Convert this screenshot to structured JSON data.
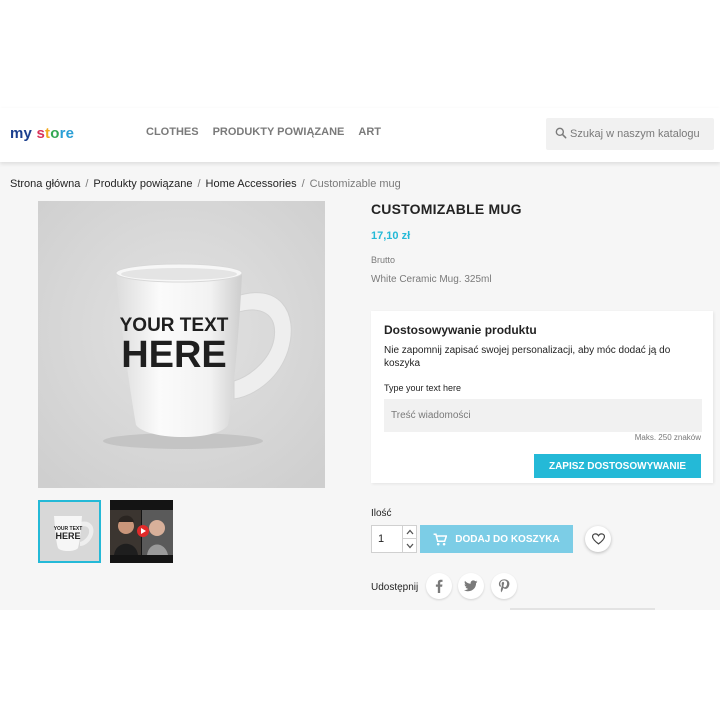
{
  "header": {
    "logo": {
      "part1": "my ",
      "part2": "s",
      "part3": "t",
      "part4": "o",
      "part5": "re"
    },
    "nav": [
      "CLOTHES",
      "PRODUKTY POWIĄZANE",
      "ART"
    ],
    "search_placeholder": "Szukaj w naszym katalogu"
  },
  "breadcrumb": [
    "Strona główna",
    "Produkty powiązane",
    "Home Accessories",
    "Customizable mug"
  ],
  "product": {
    "image_text_line1": "YOUR TEXT",
    "image_text_line2": "HERE",
    "title": "CUSTOMIZABLE MUG",
    "price": "17,10 zł",
    "tax_label": "Brutto",
    "description": "White Ceramic Mug. 325ml"
  },
  "customization": {
    "title": "Dostosowywanie produktu",
    "note": "Nie zapomnij zapisać swojej personalizacji, aby móc dodać ją do koszyka",
    "field_label": "Type your text here",
    "placeholder": "Treść wiadomości",
    "limit": "Maks. 250 znaków",
    "save_label": "ZAPISZ DOSTOSOWYWANIE"
  },
  "purchase": {
    "qty_label": "Ilość",
    "qty_value": "1",
    "add_label": "DODAJ DO KOSZYKA"
  },
  "share": {
    "label": "Udostępnij"
  },
  "colors": {
    "accent": "#24b9d7",
    "add_button": "#7ccde6",
    "text": "#232323",
    "muted": "#7a7a7a",
    "content_bg": "#f6f6f6"
  },
  "icons": [
    "search-icon",
    "chevron-up-icon",
    "chevron-down-icon",
    "cart-icon",
    "heart-icon",
    "facebook-icon",
    "twitter-icon",
    "pinterest-icon",
    "play-icon"
  ]
}
